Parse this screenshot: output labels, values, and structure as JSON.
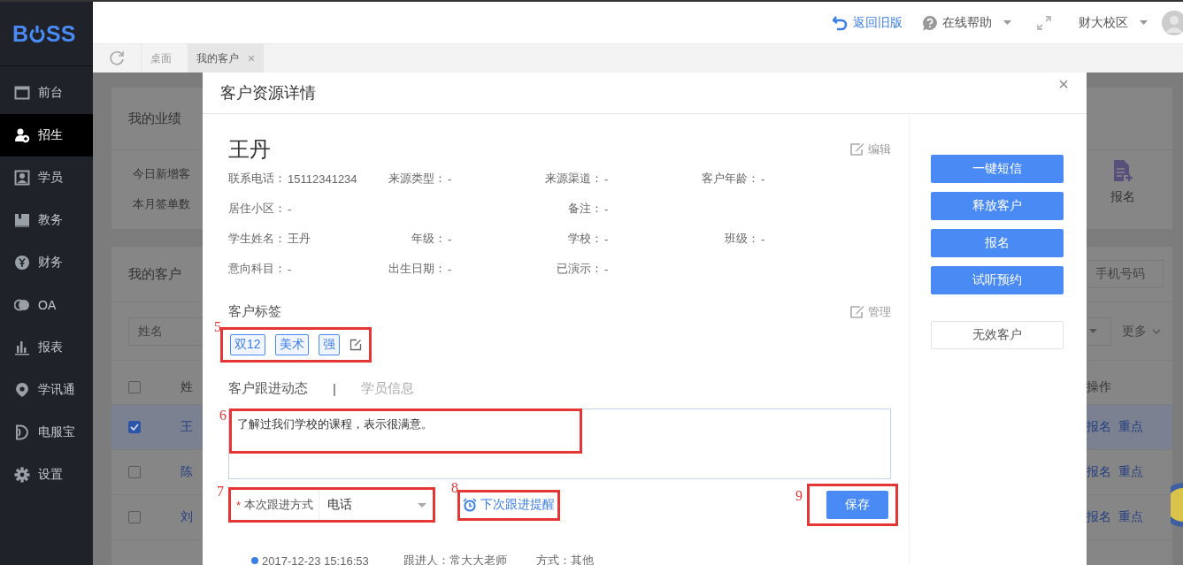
{
  "sidebar": {
    "logo": {
      "before": "B",
      "after": "SS"
    },
    "items": [
      {
        "label": "前台",
        "selected": false
      },
      {
        "label": "招生",
        "selected": true
      },
      {
        "label": "学员",
        "selected": false
      },
      {
        "label": "教务",
        "selected": false
      },
      {
        "label": "财务",
        "selected": false
      },
      {
        "label": "OA",
        "selected": false
      },
      {
        "label": "报表",
        "selected": false
      },
      {
        "label": "学讯通",
        "selected": false
      },
      {
        "label": "电服宝",
        "selected": false
      },
      {
        "label": "设置",
        "selected": false
      }
    ]
  },
  "header": {
    "back_link": "返回旧版",
    "help": "在线帮助",
    "campus": "财大校区"
  },
  "tabs": [
    {
      "label": "桌面",
      "selected": false
    },
    {
      "label": "我的客户",
      "selected": true,
      "close": "×"
    }
  ],
  "background": {
    "performance": {
      "title": "我的业绩",
      "lines": [
        "今日新增客",
        "本月签单数"
      ],
      "shortcut": "报名"
    },
    "customers": {
      "title": "我的客户",
      "phone_placeholder": "手机号码",
      "name_placeholder": "姓名",
      "more": "更多",
      "select_all": {
        "checked": false
      },
      "columns": [
        "姓",
        "操作"
      ],
      "rows": [
        {
          "checked": true,
          "name": "王",
          "actions": [
            "报名",
            "重点"
          ]
        },
        {
          "checked": false,
          "name": "陈",
          "actions": [
            "报名",
            "重点"
          ]
        },
        {
          "checked": false,
          "name": "刘",
          "actions": [
            "报名",
            "重点"
          ]
        }
      ]
    }
  },
  "modal": {
    "title": "客户资源详情",
    "close": "×",
    "name": "王丹",
    "edit": "编辑",
    "info_rows": [
      [
        {
          "kind": "field",
          "label": "联系电话：",
          "value": "15112341234"
        },
        {
          "kind": "field",
          "label": "来源类型：",
          "value": "-"
        },
        {
          "kind": "field",
          "label": "来源渠道：",
          "value": "-"
        },
        {
          "kind": "field",
          "label": "客户年龄：",
          "value": "-"
        }
      ],
      [
        {
          "kind": "field",
          "label": "居住小区：",
          "value": "-"
        },
        {
          "kind": "empty"
        },
        {
          "kind": "field",
          "label": "备注：",
          "value": "-"
        },
        {
          "kind": "empty"
        }
      ],
      [
        {
          "kind": "field",
          "label": "学生姓名：",
          "value": "王丹"
        },
        {
          "kind": "field",
          "label": "年级：",
          "value": "-"
        },
        {
          "kind": "field",
          "label": "学校：",
          "value": "-"
        },
        {
          "kind": "field",
          "label": "班级：",
          "value": "-"
        }
      ],
      [
        {
          "kind": "field",
          "label": "意向科目：",
          "value": "-"
        },
        {
          "kind": "field",
          "label": "出生日期：",
          "value": "-"
        },
        {
          "kind": "field",
          "label": "已演示：",
          "value": "-"
        },
        {
          "kind": "empty"
        }
      ]
    ],
    "tags_title": "客户标签",
    "manage": "管理",
    "tags": [
      "双12",
      "美术",
      "强"
    ],
    "tags_callout": "5",
    "tabs": [
      {
        "label": "客户跟进动态",
        "selected": true
      },
      {
        "label": "学员信息",
        "selected": false
      }
    ],
    "tab_separator": "|",
    "note": {
      "value": "了解过我们学校的课程，表示很满意。",
      "callout": "6"
    },
    "method": {
      "required_mark": "*",
      "label": "本次跟进方式",
      "value": "电话",
      "callout": "7"
    },
    "reminder": {
      "label": "下次跟进提醒",
      "callout": "8"
    },
    "save": {
      "label": "保存",
      "callout": "9"
    },
    "history": [
      {
        "time": "2017-12-23 15:16:53",
        "follower": "跟进人：常大大老师",
        "method": "方式：其他"
      }
    ],
    "actions": [
      {
        "label": "一键短信",
        "kind": "primary"
      },
      {
        "label": "释放客户",
        "kind": "primary"
      },
      {
        "label": "报名",
        "kind": "primary"
      },
      {
        "label": "试听预约",
        "kind": "primary"
      },
      {
        "label": "无效客户",
        "kind": "plain"
      }
    ]
  }
}
